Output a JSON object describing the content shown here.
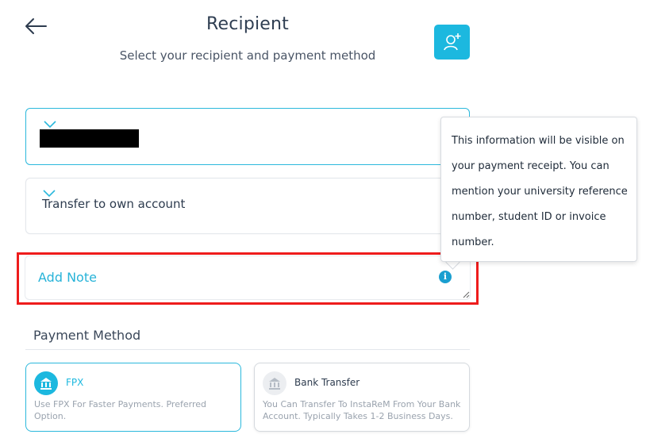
{
  "header": {
    "title": "Recipient",
    "subtitle": "Select your recipient and payment method"
  },
  "recipient_select": {
    "value": ""
  },
  "transfer_select": {
    "value": "Transfer to own account"
  },
  "note": {
    "placeholder": "Add Note"
  },
  "tooltip": {
    "lines": [
      "This information will be visible on",
      "your payment receipt. You can",
      "mention your university reference",
      "number, student ID or invoice",
      "number."
    ]
  },
  "payment_method": {
    "label": "Payment Method",
    "options": [
      {
        "title": "FPX",
        "desc_lines": [
          "Use FPX For Faster Payments. Preferred",
          "Option."
        ],
        "selected": true
      },
      {
        "title": "Bank Transfer",
        "desc_lines": [
          "You Can Transfer To InstaReM From Your Bank",
          "Account. Typically Takes 1-2 Business Days."
        ],
        "selected": false
      }
    ]
  },
  "colors": {
    "accent": "#1cb8df",
    "highlight": "#ee1c1c",
    "text": "#2d3b4e"
  },
  "icons": [
    "back-arrow-icon",
    "add-person-icon",
    "chevron-down-icon",
    "info-icon",
    "bank-icon"
  ]
}
